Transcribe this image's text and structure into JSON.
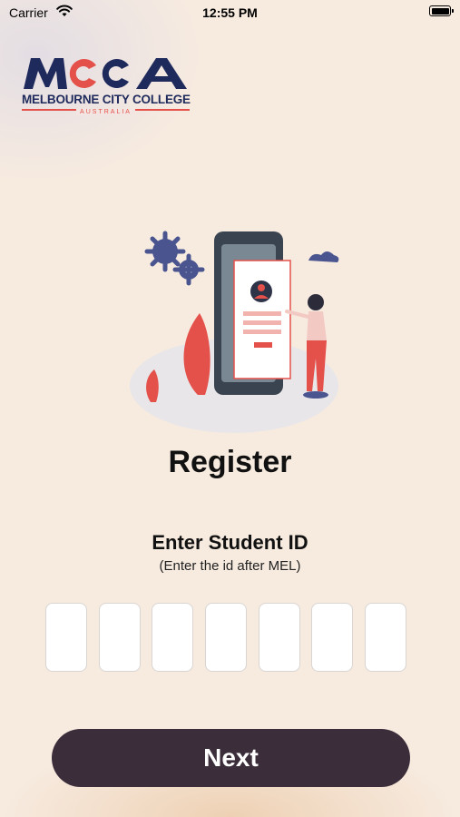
{
  "status_bar": {
    "carrier": "Carrier",
    "time": "12:55 PM"
  },
  "logo": {
    "mark_text": "MCCA",
    "line1": "MELBOURNE CITY COLLEGE",
    "line2": "AUSTRALIA",
    "brand_color": "#1f2a5c",
    "accent_color": "#e4514a"
  },
  "register": {
    "title": "Register",
    "label": "Enter Student ID",
    "hint": "(Enter the id after MEL)"
  },
  "student_id": {
    "digits": [
      "",
      "",
      "",
      "",
      "",
      "",
      ""
    ]
  },
  "next_button": {
    "label": "Next",
    "color": "#3b2d3a"
  },
  "icons": {
    "wifi": "wifi-icon",
    "battery": "battery-icon",
    "illustration": "registration-illustration"
  }
}
